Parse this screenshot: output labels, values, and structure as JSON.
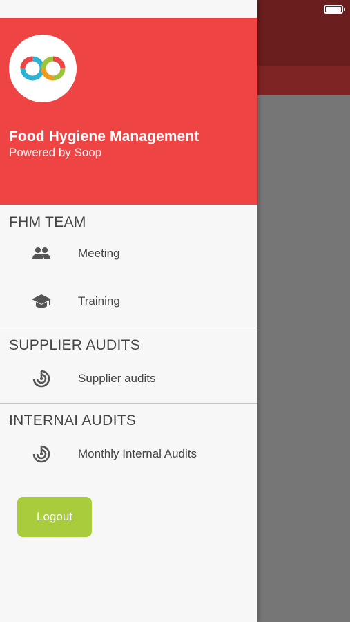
{
  "header": {
    "title": "Food Hygiene Management",
    "subtitle": "Powered by Soop"
  },
  "sections": [
    {
      "title": "FHM TEAM",
      "items": [
        {
          "label": "Meeting",
          "icon": "people-icon"
        },
        {
          "label": "Training",
          "icon": "graduation-cap-icon"
        }
      ]
    },
    {
      "title": "SUPPLIER AUDITS",
      "items": [
        {
          "label": "Supplier audits",
          "icon": "audit-target-icon"
        }
      ]
    },
    {
      "title": "INTERNAI AUDITS",
      "items": [
        {
          "label": "Monthly Internal Audits",
          "icon": "audit-target-icon"
        }
      ]
    }
  ],
  "logout_label": "Logout",
  "colors": {
    "header_bg": "#ef4444",
    "logout_bg": "#a8cc3c",
    "drawer_bg": "#f7f7f7",
    "overlay": "#767676"
  }
}
